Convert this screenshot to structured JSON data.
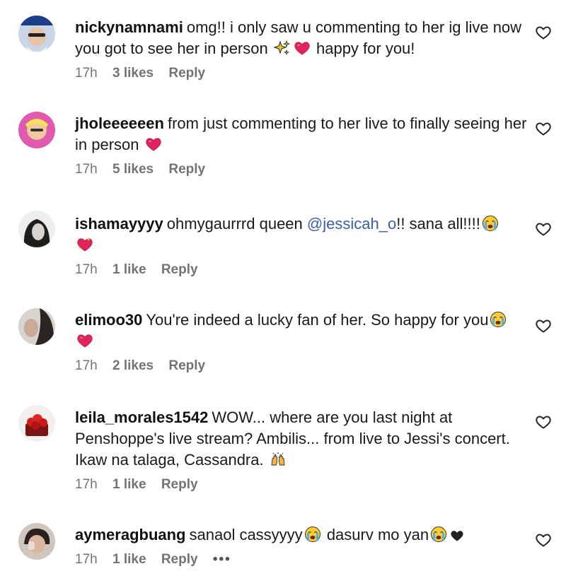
{
  "comments": [
    {
      "username": "nickynamnami",
      "text_before": "omg!! i only saw u commenting to her ig live now you got to see her in person",
      "text_after": "happy for you!",
      "time": "17h",
      "likes": "3 likes",
      "reply": "Reply"
    },
    {
      "username": "jholeeeeeen",
      "text_before": "from just commenting to her live to finally seeing her in person",
      "time": "17h",
      "likes": "5 likes",
      "reply": "Reply"
    },
    {
      "username": "ishamayyyy",
      "text_before": "ohmygaurrrd queen",
      "mention": "@jessicah_o",
      "text_after": "!! sana all!!!!",
      "time": "17h",
      "likes": "1 like",
      "reply": "Reply"
    },
    {
      "username": "elimoo30",
      "text_before": "You're indeed a lucky fan of her. So happy for you",
      "time": "17h",
      "likes": "2 likes",
      "reply": "Reply"
    },
    {
      "username": "leila_morales1542",
      "text_before": "WOW... where are you last night at Penshoppe's live stream? Ambilis... from live to Jessi's concert. Ikaw na talaga, Cassandra.",
      "time": "17h",
      "likes": "1 like",
      "reply": "Reply"
    },
    {
      "username": "aymeragbuang",
      "text_before": "sanaol cassyyyy",
      "text_after": "dasurv mo yan",
      "time": "17h",
      "likes": "1 like",
      "reply": "Reply",
      "more": "•••"
    }
  ],
  "icons": {
    "like": "heart-outline-icon",
    "red_heart": "red-heart-emoji",
    "sparkles": "sparkles-emoji",
    "crying": "crying-face-emoji",
    "sparkling_heart": "sparkling-heart-emoji",
    "raised_hands": "raised-hands-emoji",
    "black_heart": "black-heart-emoji"
  },
  "colors": {
    "meta": "#737373",
    "mention": "#3b5ea8",
    "heart_red": "#e0245e"
  }
}
